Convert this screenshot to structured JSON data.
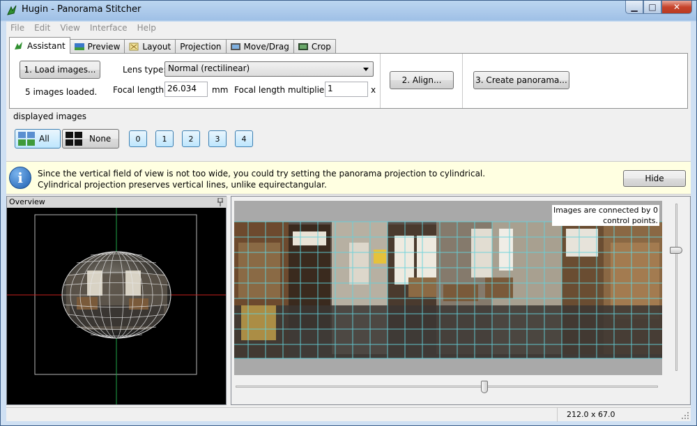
{
  "window": {
    "title": "Hugin - Panorama Stitcher"
  },
  "menu": [
    "File",
    "Edit",
    "View",
    "Interface",
    "Help"
  ],
  "tabs": [
    "Assistant",
    "Preview",
    "Layout",
    "Projection",
    "Move/Drag",
    "Crop"
  ],
  "assistant": {
    "load_button": "1. Load images...",
    "images_loaded": "5 images loaded.",
    "lens_type_label": "Lens type:",
    "lens_type_value": "Normal (rectilinear)",
    "focal_length_label": "Focal length:",
    "focal_length_value": "26.034",
    "focal_length_unit": "mm",
    "multiplier_label": "Focal length multiplier:",
    "multiplier_value": "1",
    "multiplier_unit": "x",
    "align_button": "2. Align...",
    "create_button": "3. Create panorama..."
  },
  "displayed": {
    "label": "displayed images",
    "all_button": "All",
    "none_button": "None",
    "image_buttons": [
      "0",
      "1",
      "2",
      "3",
      "4"
    ]
  },
  "info": {
    "line1": "Since the vertical field of view is not too wide, you could try setting the panorama projection to cylindrical.",
    "line2": "Cylindrical projection preserves vertical lines, unlike equirectangular.",
    "hide_button": "Hide"
  },
  "overview": {
    "title": "Overview"
  },
  "preview": {
    "connection_line1": "Images are connected by 0",
    "connection_line2": "control points.",
    "horizontal_slider_position": 0.59,
    "vertical_slider_position": 0.27
  },
  "status": {
    "size": "212.0 x 67.0"
  },
  "colors": {
    "grid": "#64d2dc",
    "crosshair_red": "#c8201e",
    "crosshair_green": "#1fa64a",
    "info_bg": "#ffffe1"
  }
}
